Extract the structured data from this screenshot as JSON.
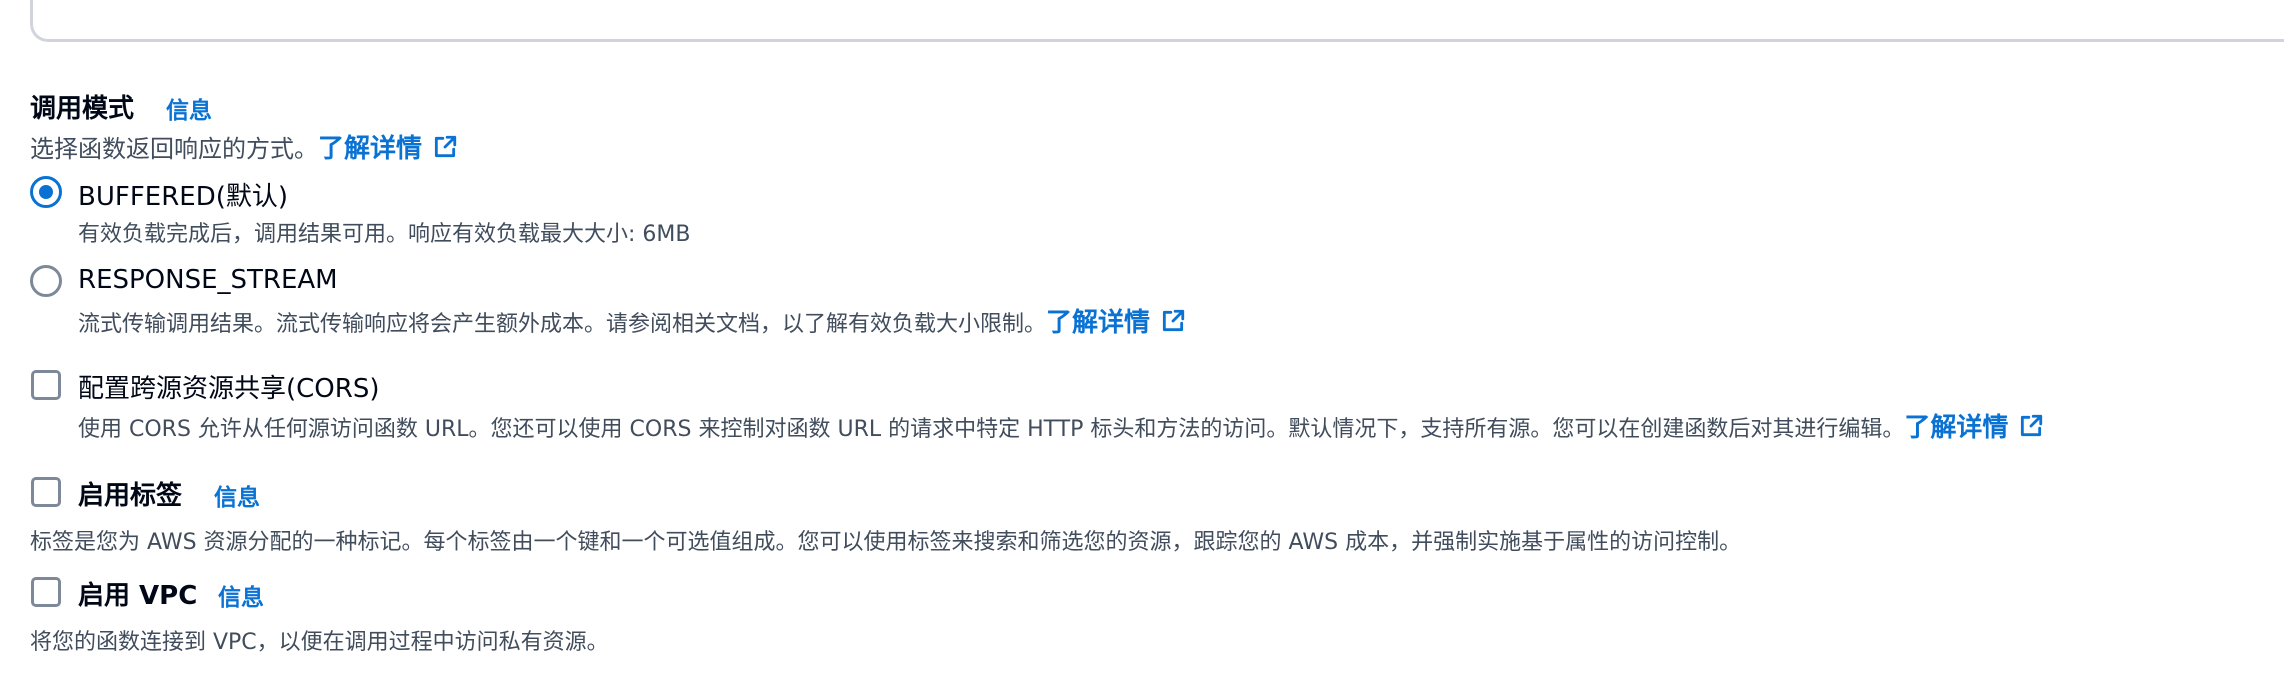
{
  "invoke_mode": {
    "title": "调用模式",
    "info": "信息",
    "description": "选择函数返回响应的方式。",
    "learn_more": "了解详情",
    "options": [
      {
        "label": "BUFFERED(默认)",
        "description": "有效负载完成后，调用结果可用。响应有效负载最大大小: 6MB",
        "selected": true
      },
      {
        "label": "RESPONSE_STREAM",
        "description": "流式传输调用结果。流式传输响应将会产生额外成本。请参阅相关文档，以了解有效负载大小限制。",
        "learn_more": "了解详情",
        "selected": false
      }
    ]
  },
  "cors": {
    "label": "配置跨源资源共享(CORS)",
    "description": "使用 CORS 允许从任何源访问函数 URL。您还可以使用 CORS 来控制对函数 URL 的请求中特定 HTTP 标头和方法的访问。默认情况下，支持所有源。您可以在创建函数后对其进行编辑。",
    "learn_more": "了解详情",
    "checked": false
  },
  "tags": {
    "label": "启用标签",
    "info": "信息",
    "description": "标签是您为 AWS 资源分配的一种标记。每个标签由一个键和一个可选值组成。您可以使用标签来搜索和筛选您的资源，跟踪您的 AWS 成本，并强制实施基于属性的访问控制。",
    "checked": false
  },
  "vpc": {
    "label": "启用 VPC",
    "info": "信息",
    "description": "将您的函数连接到 VPC，以便在调用过程中访问私有资源。",
    "checked": false
  },
  "colors": {
    "link": "#0972d3",
    "text": "#000716",
    "secondary_text": "#414d5c",
    "control_border": "#7d8998"
  },
  "icons": {
    "external_link": "external-link-icon"
  }
}
